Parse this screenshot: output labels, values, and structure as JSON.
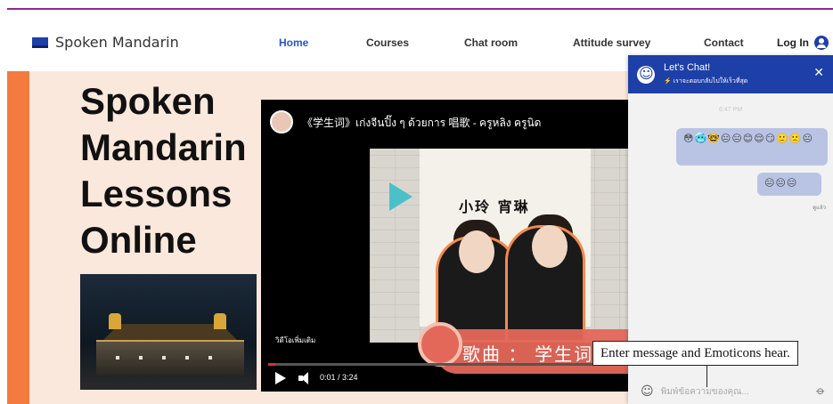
{
  "brand": {
    "name": "Spoken Mandarin",
    "accent": "#1d3fa8",
    "frame_line": "#8e2b8e"
  },
  "nav": {
    "items": [
      {
        "label": "Home",
        "active": true
      },
      {
        "label": "Courses"
      },
      {
        "label": "Chat room"
      },
      {
        "label": "Attitude survey"
      },
      {
        "label": "Contact"
      }
    ],
    "login_label": "Log In"
  },
  "hero": {
    "title": "Spoken Mandarin Lessons Online",
    "panel_color": "#fbe8dc",
    "bar_color": "#f47b3f"
  },
  "video": {
    "title": "《学生词》เก่งจีนปิ๊ง ๆ ด้วยการ 唱歌 - ครูหลิง ครูนิด",
    "names": "小玲  宵琳",
    "song_label": "歌曲 ： 学生词",
    "more_videos": "วิดีโอเพิ่มเติม",
    "time": "0:01 / 3:24",
    "progress": 0.005
  },
  "chat": {
    "title": "Let's Chat!",
    "subtitle": "⚡ เราจะตอบกลับไปให้เร็วที่สุด",
    "timestamp": "6:47 PM",
    "messages": [
      {
        "text": "😳🥶🤓😐😑😊😌😏🙂🙁😐"
      },
      {
        "text": "😐😐😐"
      }
    ],
    "read_label": "ดูแล้ว",
    "input_placeholder": "พิมพ์ข้อความของคุณ...",
    "icons": {
      "avatar": "smile-icon",
      "close": "close-icon",
      "emoji": "emoji-icon",
      "attach": "paperclip-icon"
    }
  },
  "annotation": {
    "text": "Enter message and Emoticons hear."
  }
}
